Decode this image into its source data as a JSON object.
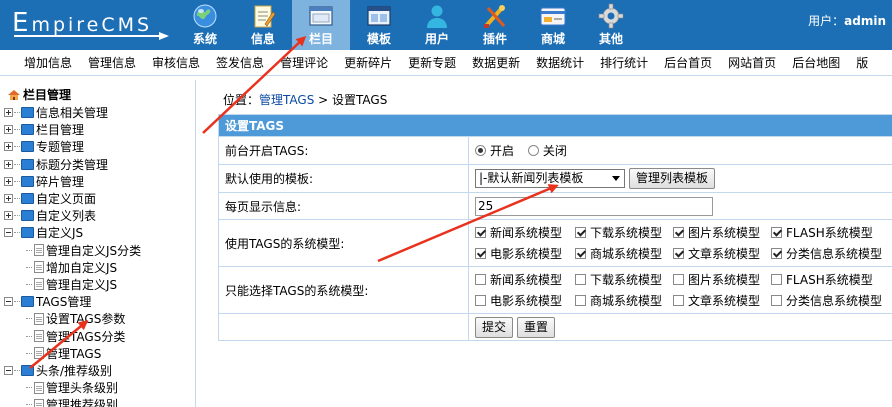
{
  "header": {
    "logo_text_first": "E",
    "logo_text_rest": "mpireCMS",
    "nav": [
      {
        "label": "系统",
        "icon": "globe-icon"
      },
      {
        "label": "信息",
        "icon": "notepad-icon"
      },
      {
        "label": "栏目",
        "icon": "window-icon",
        "active": true
      },
      {
        "label": "模板",
        "icon": "window-template-icon"
      },
      {
        "label": "用户",
        "icon": "user-icon"
      },
      {
        "label": "插件",
        "icon": "tools-icon"
      },
      {
        "label": "商城",
        "icon": "card-icon"
      },
      {
        "label": "其他",
        "icon": "gear-icon"
      }
    ],
    "user_label": "用户：",
    "user_name": "admin"
  },
  "subnav": [
    "增加信息",
    "管理信息",
    "审核信息",
    "签发信息",
    "管理评论",
    "更新碎片",
    "更新专题",
    "数据更新",
    "数据统计",
    "排行统计",
    "后台首页",
    "网站首页",
    "后台地图",
    "版"
  ],
  "sidebar": {
    "title": "栏目管理",
    "items": [
      {
        "label": "信息相关管理"
      },
      {
        "label": "栏目管理"
      },
      {
        "label": "专题管理"
      },
      {
        "label": "标题分类管理"
      },
      {
        "label": "碎片管理"
      },
      {
        "label": "自定义页面"
      },
      {
        "label": "自定义列表"
      },
      {
        "label": "自定义JS",
        "children": [
          "管理自定义JS分类",
          "增加自定义JS",
          "管理自定义JS"
        ]
      },
      {
        "label": "TAGS管理",
        "children": [
          "设置TAGS参数",
          "管理TAGS分类",
          "管理TAGS"
        ]
      },
      {
        "label": "头条/推荐级别",
        "children": [
          "管理头条级别",
          "管理推荐级别"
        ]
      }
    ]
  },
  "main": {
    "breadcrumb_prefix": "位置：",
    "breadcrumb_link": "管理TAGS",
    "breadcrumb_sep": " > ",
    "breadcrumb_current": "设置TAGS",
    "table_title": "设置TAGS",
    "row_open_label": "前台开启TAGS:",
    "radio_on": "开启",
    "radio_off": "关闭",
    "row_template_label": "默认使用的模板:",
    "template_selected": "|-默认新闻列表模板",
    "manage_template_button": "管理列表模板",
    "row_perpage_label": "每页显示信息:",
    "perpage_value": "25",
    "row_models_label": "使用TAGS的系统模型:",
    "row_select_models_label": "只能选择TAGS的系统模型:",
    "models": [
      "新闻系统模型",
      "下载系统模型",
      "图片系统模型",
      "FLASH系统模型",
      "电影系统模型",
      "商城系统模型",
      "文章系统模型",
      "分类信息系统模型"
    ],
    "submit_button": "提交",
    "reset_button": "重置"
  },
  "colors": {
    "header_bg": "#1d6fb5",
    "nav_active_bg": "#7fb3df",
    "table_header_bg": "#4e9ad8",
    "annotation_arrow": "#e8321e"
  }
}
